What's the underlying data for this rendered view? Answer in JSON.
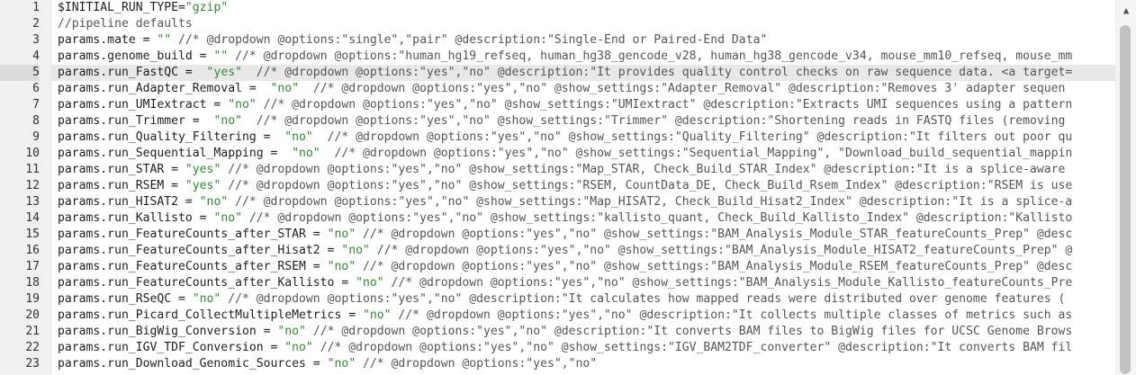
{
  "lines": [
    {
      "n": "1",
      "segs": [
        {
          "t": "$INITIAL_RUN_TYPE=",
          "k": ""
        },
        {
          "t": "\"gzip\"",
          "k": "s"
        }
      ]
    },
    {
      "n": "2",
      "segs": [
        {
          "t": "//pipeline defaults",
          "k": "c"
        }
      ]
    },
    {
      "n": "3",
      "segs": [
        {
          "t": "params.mate = ",
          "k": ""
        },
        {
          "t": "\"\"",
          "k": "s"
        },
        {
          "t": " //* @dropdown @options:\"single\",\"pair\" @description:\"Single-End or Paired-End Data\"",
          "k": "c"
        }
      ]
    },
    {
      "n": "4",
      "segs": [
        {
          "t": "params.genome_build = ",
          "k": ""
        },
        {
          "t": "\"\"",
          "k": "s"
        },
        {
          "t": " //* @dropdown @options:\"human_hg19_refseq, human_hg38_gencode_v28, human_hg38_gencode_v34, mouse_mm10_refseq, mouse_mm",
          "k": "c"
        }
      ]
    },
    {
      "n": "5",
      "segs": [
        {
          "t": "params.run_FastQC =  ",
          "k": ""
        },
        {
          "t": "\"yes\"",
          "k": "s"
        },
        {
          "t": "  //* @dropdown @options:\"yes\",\"no\" @description:\"It provides quality control checks on raw sequence data. <a target=",
          "k": "c"
        }
      ]
    },
    {
      "n": "6",
      "segs": [
        {
          "t": "params.run_Adapter_Removal =  ",
          "k": ""
        },
        {
          "t": "\"no\"",
          "k": "s"
        },
        {
          "t": "  //* @dropdown @options:\"yes\",\"no\" @show_settings:\"Adapter_Removal\" @description:\"Removes 3' adapter sequen",
          "k": "c"
        }
      ]
    },
    {
      "n": "7",
      "segs": [
        {
          "t": "params.run_UMIextract = ",
          "k": ""
        },
        {
          "t": "\"no\"",
          "k": "s"
        },
        {
          "t": " //* @dropdown @options:\"yes\",\"no\" @show_settings:\"UMIextract\" @description:\"Extracts UMI sequences using a pattern",
          "k": "c"
        }
      ]
    },
    {
      "n": "8",
      "segs": [
        {
          "t": "params.run_Trimmer =  ",
          "k": ""
        },
        {
          "t": "\"no\"",
          "k": "s"
        },
        {
          "t": "  //* @dropdown @options:\"yes\",\"no\" @show_settings:\"Trimmer\" @description:\"Shortening reads in FASTQ files (removing",
          "k": "c"
        }
      ]
    },
    {
      "n": "9",
      "segs": [
        {
          "t": "params.run_Quality_Filtering =  ",
          "k": ""
        },
        {
          "t": "\"no\"",
          "k": "s"
        },
        {
          "t": "  //* @dropdown @options:\"yes\",\"no\" @show_settings:\"Quality_Filtering\" @description:\"It filters out poor qu",
          "k": "c"
        }
      ]
    },
    {
      "n": "10",
      "segs": [
        {
          "t": "params.run_Sequential_Mapping =  ",
          "k": ""
        },
        {
          "t": "\"no\"",
          "k": "s"
        },
        {
          "t": "  //* @dropdown @options:\"yes\",\"no\" @show_settings:\"Sequential_Mapping\", \"Download_build_sequential_mappin",
          "k": "c"
        }
      ]
    },
    {
      "n": "11",
      "segs": [
        {
          "t": "params.run_STAR = ",
          "k": ""
        },
        {
          "t": "\"yes\"",
          "k": "s"
        },
        {
          "t": " //* @dropdown @options:\"yes\",\"no\" @show_settings:\"Map_STAR, Check_Build_STAR_Index\" @description:\"It is a splice-aware",
          "k": "c"
        }
      ]
    },
    {
      "n": "12",
      "segs": [
        {
          "t": "params.run_RSEM = ",
          "k": ""
        },
        {
          "t": "\"yes\"",
          "k": "s"
        },
        {
          "t": " //* @dropdown @options:\"yes\",\"no\" @show_settings:\"RSEM, CountData_DE, Check_Build_Rsem_Index\" @description:\"RSEM is use",
          "k": "c"
        }
      ]
    },
    {
      "n": "13",
      "segs": [
        {
          "t": "params.run_HISAT2 = ",
          "k": ""
        },
        {
          "t": "\"no\"",
          "k": "s"
        },
        {
          "t": " //* @dropdown @options:\"yes\",\"no\" @show_settings:\"Map_HISAT2, Check_Build_Hisat2_Index\" @description:\"It is a splice-a",
          "k": "c"
        }
      ]
    },
    {
      "n": "14",
      "segs": [
        {
          "t": "params.run_Kallisto = ",
          "k": ""
        },
        {
          "t": "\"no\"",
          "k": "s"
        },
        {
          "t": " //* @dropdown @options:\"yes\",\"no\" @show_settings:\"kallisto_quant, Check_Build_Kallisto_Index\" @description:\"Kallisto",
          "k": "c"
        }
      ]
    },
    {
      "n": "15",
      "segs": [
        {
          "t": "params.run_FeatureCounts_after_STAR = ",
          "k": ""
        },
        {
          "t": "\"no\"",
          "k": "s"
        },
        {
          "t": " //* @dropdown @options:\"yes\",\"no\" @show_settings:\"BAM_Analysis_Module_STAR_featureCounts_Prep\" @desc",
          "k": "c"
        }
      ]
    },
    {
      "n": "16",
      "segs": [
        {
          "t": "params.run_FeatureCounts_after_Hisat2 = ",
          "k": ""
        },
        {
          "t": "\"no\"",
          "k": "s"
        },
        {
          "t": " //* @dropdown @options:\"yes\",\"no\" @show_settings:\"BAM_Analysis_Module_HISAT2_featureCounts_Prep\" @",
          "k": "c"
        }
      ]
    },
    {
      "n": "17",
      "segs": [
        {
          "t": "params.run_FeatureCounts_after_RSEM = ",
          "k": ""
        },
        {
          "t": "\"no\"",
          "k": "s"
        },
        {
          "t": " //* @dropdown @options:\"yes\",\"no\" @show_settings:\"BAM_Analysis_Module_RSEM_featureCounts_Prep\" @desc",
          "k": "c"
        }
      ]
    },
    {
      "n": "18",
      "segs": [
        {
          "t": "params.run_FeatureCounts_after_Kallisto = ",
          "k": ""
        },
        {
          "t": "\"no\"",
          "k": "s"
        },
        {
          "t": " //* @dropdown @options:\"yes\",\"no\" @show_settings:\"BAM_Analysis_Module_Kallisto_featureCounts_Pre",
          "k": "c"
        }
      ]
    },
    {
      "n": "19",
      "segs": [
        {
          "t": "params.run_RSeQC = ",
          "k": ""
        },
        {
          "t": "\"no\"",
          "k": "s"
        },
        {
          "t": " //* @dropdown @options:\"yes\",\"no\" @description:\"It calculates how mapped reads were distributed over genome features (",
          "k": "c"
        }
      ]
    },
    {
      "n": "20",
      "segs": [
        {
          "t": "params.run_Picard_CollectMultipleMetrics = ",
          "k": ""
        },
        {
          "t": "\"no\"",
          "k": "s"
        },
        {
          "t": " //* @dropdown @options:\"yes\",\"no\" @description:\"It collects multiple classes of metrics such as",
          "k": "c"
        }
      ]
    },
    {
      "n": "21",
      "segs": [
        {
          "t": "params.run_BigWig_Conversion = ",
          "k": ""
        },
        {
          "t": "\"no\"",
          "k": "s"
        },
        {
          "t": " //* @dropdown @options:\"yes\",\"no\" @description:\"It converts BAM files to BigWig files for UCSC Genome Brows",
          "k": "c"
        }
      ]
    },
    {
      "n": "22",
      "segs": [
        {
          "t": "params.run_IGV_TDF_Conversion = ",
          "k": ""
        },
        {
          "t": "\"no\"",
          "k": "s"
        },
        {
          "t": " //* @dropdown @options:\"yes\",\"no\" @show_settings:\"IGV_BAM2TDF_converter\" @description:\"It converts BAM fil",
          "k": "c"
        }
      ]
    },
    {
      "n": "23",
      "segs": [
        {
          "t": "params.run_Download_Genomic_Sources = ",
          "k": ""
        },
        {
          "t": "\"no\"",
          "k": "s"
        },
        {
          "t": " //* @dropdown @options:\"yes\",\"no\"",
          "k": "c"
        }
      ]
    }
  ],
  "highlight_line": "5",
  "scrollbar": {
    "up_arrow_glyph": "▲"
  },
  "colors": {
    "string": "#2e8b2e",
    "comment": "#555555",
    "text": "#1e1e1e",
    "gutter_bg": "#f0f0f0",
    "highlight_bg": "#e8e8e8"
  }
}
